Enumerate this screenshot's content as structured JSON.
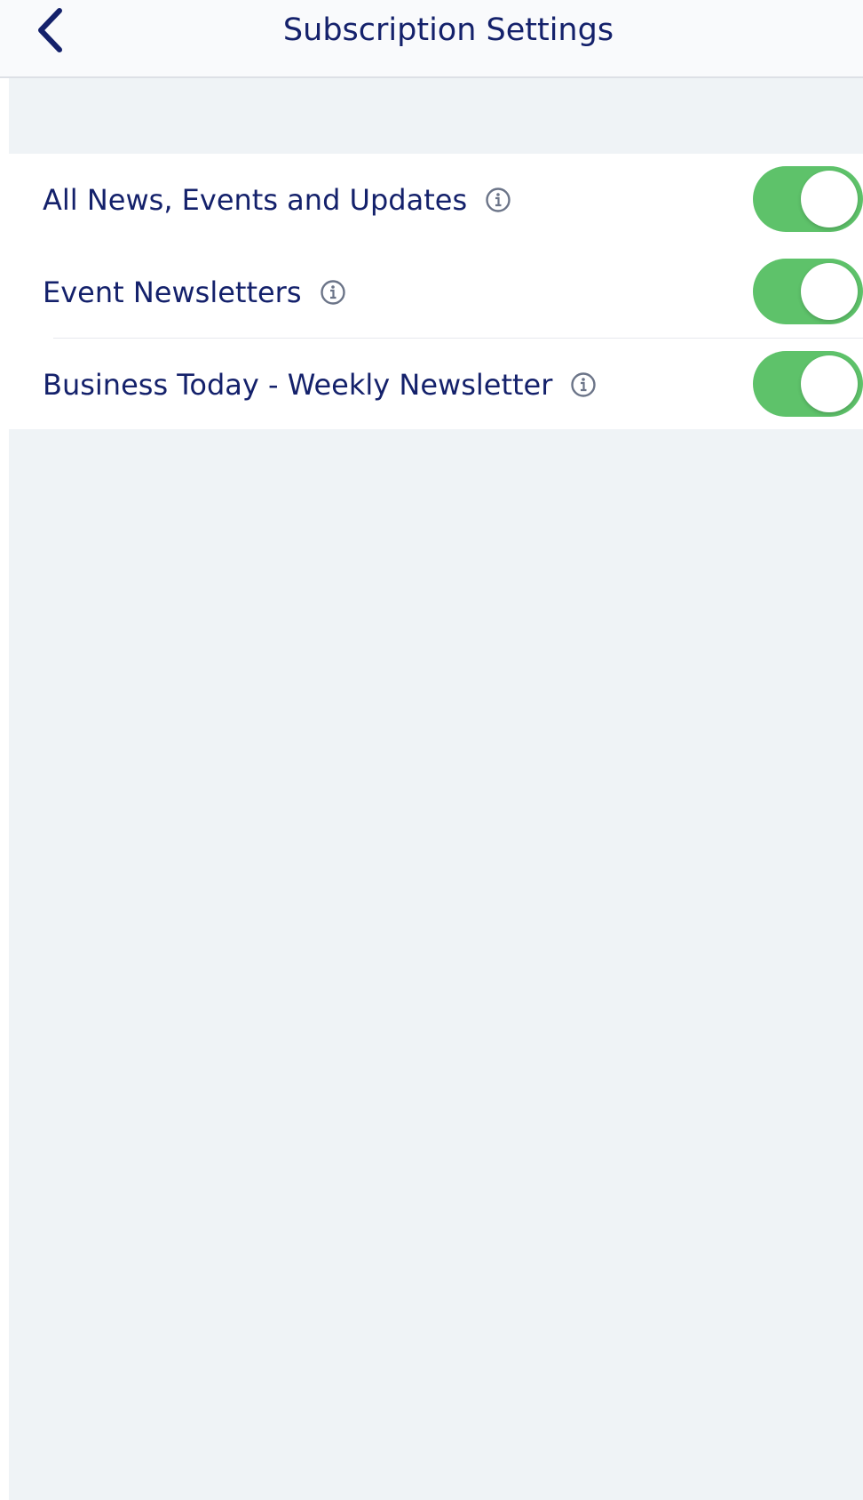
{
  "header": {
    "title": "Subscription Settings",
    "back_icon": "chevron-left-icon"
  },
  "colors": {
    "title": "#14216b",
    "toggle_on": "#5ec26a",
    "background": "#eff3f6"
  },
  "settings": [
    {
      "label": "All News, Events and Updates",
      "info_icon": "info-icon",
      "enabled": true
    },
    {
      "label": "Event Newsletters",
      "info_icon": "info-icon",
      "enabled": true
    },
    {
      "label": "Business Today - Weekly Newsletter",
      "info_icon": "info-icon",
      "enabled": true
    }
  ]
}
